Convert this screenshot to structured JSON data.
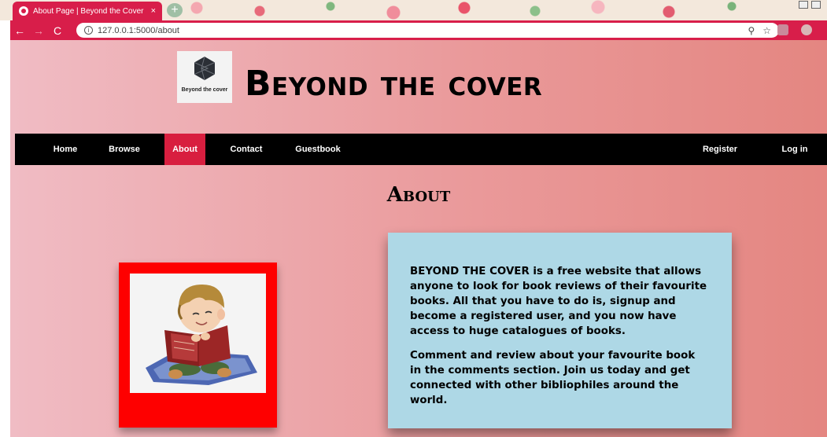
{
  "browser": {
    "tab_title": "About Page | Beyond the Cover",
    "tab_close": "×",
    "new_tab": "+",
    "back": "←",
    "forward": "→",
    "reload": "C",
    "url": "127.0.0.1:5000/about",
    "info_icon": "i",
    "zoom_icon": "⚲",
    "star_icon": "☆"
  },
  "site": {
    "logo_text": "Beyond the cover",
    "title": "Beyond the cover"
  },
  "nav": {
    "items": [
      {
        "label": "Home"
      },
      {
        "label": "Browse"
      },
      {
        "label": "About"
      },
      {
        "label": "Contact"
      },
      {
        "label": "Guestbook"
      },
      {
        "label": "Register"
      },
      {
        "label": "Log in"
      }
    ],
    "active": "About"
  },
  "main": {
    "heading": "About",
    "paragraphs": [
      "BEYOND THE COVER is a free website that allows anyone to look for book reviews of their favourite books. All that you have to do is, signup and become a registered user, and you now have access to huge catalogues of books.",
      "Comment and review about your favourite book in the comments section. Join us today and get connected with other bibliophiles around the world."
    ]
  },
  "colors": {
    "chrome": "#d81e4a",
    "nav_active": "#d81e3f",
    "photo_frame": "#fe0000",
    "card": "#aed8e6"
  }
}
